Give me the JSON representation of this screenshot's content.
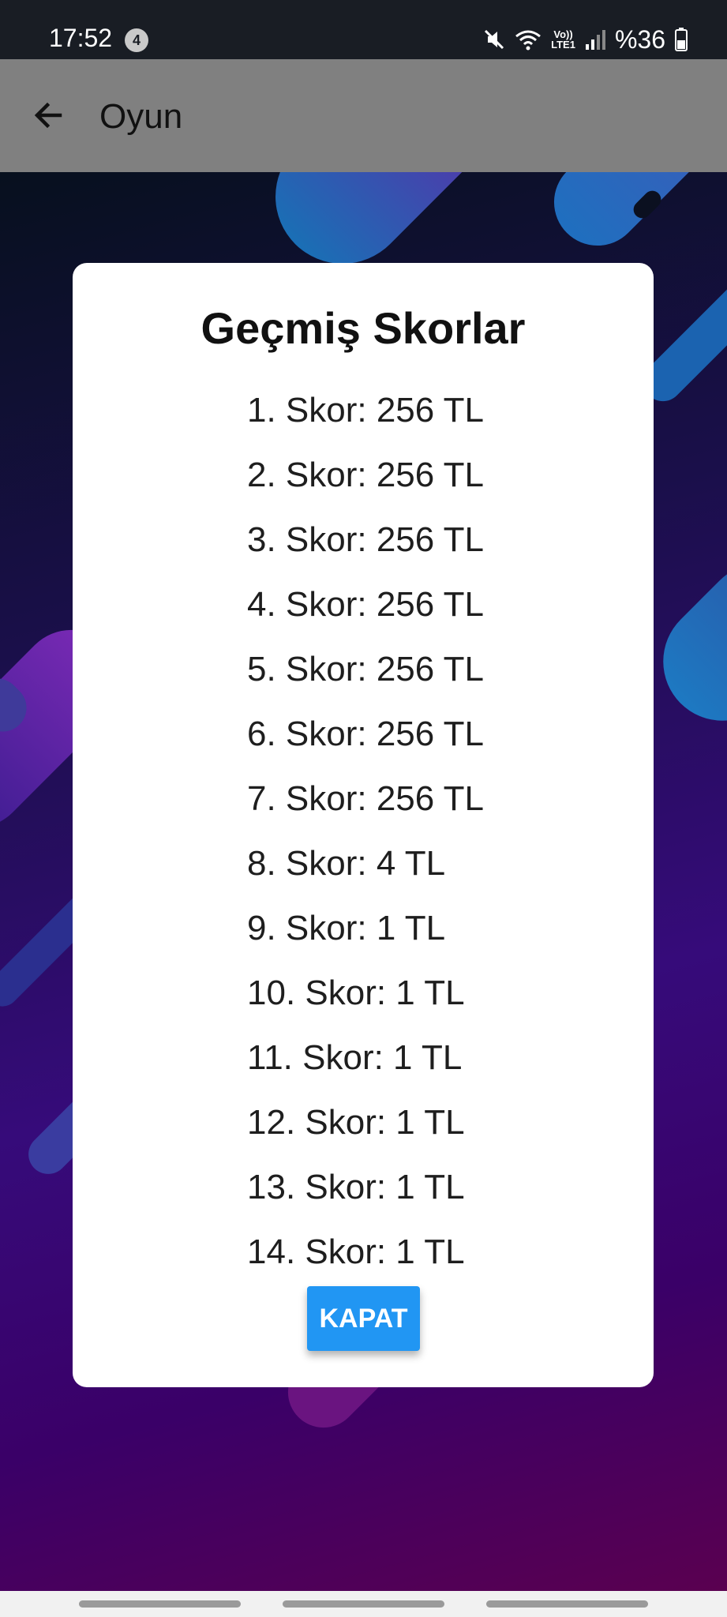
{
  "status_bar": {
    "time": "17:52",
    "notification_count": "4",
    "network_label_top": "Vo))",
    "network_label_bottom": "LTE1",
    "battery": "%36"
  },
  "app_bar": {
    "title": "Oyun",
    "back_icon": "arrow-left-icon"
  },
  "dialog": {
    "title": "Geçmiş Skorlar",
    "scores": [
      "1. Skor: 256 TL",
      "2. Skor: 256 TL",
      "3. Skor: 256 TL",
      "4. Skor: 256 TL",
      "5. Skor: 256 TL",
      "6. Skor: 256 TL",
      "7. Skor: 256 TL",
      "8. Skor: 4 TL",
      "9. Skor: 1 TL",
      "10. Skor: 1 TL",
      "11. Skor: 1 TL",
      "12. Skor: 1 TL",
      "13. Skor: 1 TL",
      "14. Skor: 1 TL"
    ],
    "close_button": "KAPAT"
  },
  "colors": {
    "button_accent": "#2196f3",
    "app_bar": "#808080",
    "status_bar": "#191d24"
  }
}
